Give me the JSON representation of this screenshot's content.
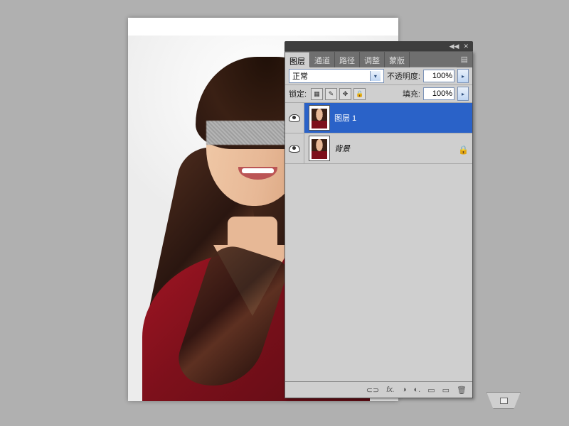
{
  "tabs": {
    "layers": "图层",
    "channels": "通道",
    "paths": "路径",
    "adjust": "调整",
    "masks": "蒙版"
  },
  "blend": {
    "mode": "正常",
    "opacity_label": "不透明度:",
    "opacity_value": "100%"
  },
  "lock": {
    "label": "锁定:",
    "fill_label": "填充:",
    "fill_value": "100%"
  },
  "layers": [
    {
      "name": "图层 1",
      "locked": false
    },
    {
      "name": "背景",
      "locked": true
    }
  ],
  "footer": {
    "link": "⊂⊃",
    "fx": "fx.",
    "mask": "◑",
    "adj": "◐.",
    "group": "▭",
    "new": "▭",
    "trash": "🗑"
  }
}
